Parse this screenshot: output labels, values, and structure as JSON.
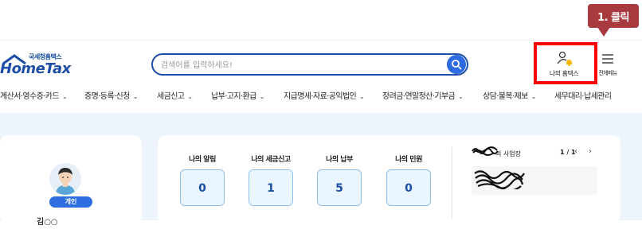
{
  "header": {
    "logo_sub": "국세청홈택스",
    "logo_main": "HomeTax",
    "search_placeholder": "검색어를 입력하세요!",
    "my_hometax_label": "나의 홈택스",
    "all_menu_label": "전체메뉴"
  },
  "callout": {
    "text": "1. 클릭"
  },
  "nav": {
    "items": [
      "계산서·영수증·카드",
      "증명·등록·신청",
      "세금신고",
      "납부·고지·환급",
      "지급명세·자료·공익법인",
      "장려금·연말정산·기부금",
      "상담·불복·제보",
      "세무대리·납세관리"
    ]
  },
  "profile": {
    "badge": "개인",
    "name": "김○○"
  },
  "stats": {
    "items": [
      {
        "title": "나의 알림",
        "value": "0"
      },
      {
        "title": "나의 세금신고",
        "value": "1"
      },
      {
        "title": "나의 납부",
        "value": "5"
      },
      {
        "title": "나의 민원",
        "value": "0"
      }
    ]
  },
  "business": {
    "label": "의 사업장",
    "pager": "1 / 1",
    "prev": "‹",
    "next": "›"
  },
  "colors": {
    "brand": "#1d4fa8",
    "accent": "#2f6be0",
    "highlight": "#ff0000",
    "callout": "#a83a3f",
    "band": "#eef4fb"
  },
  "icons": [
    "search-icon",
    "user-bell-icon",
    "hamburger-menu-icon",
    "chevron-down-icon",
    "chevron-left-icon",
    "chevron-right-icon"
  ]
}
